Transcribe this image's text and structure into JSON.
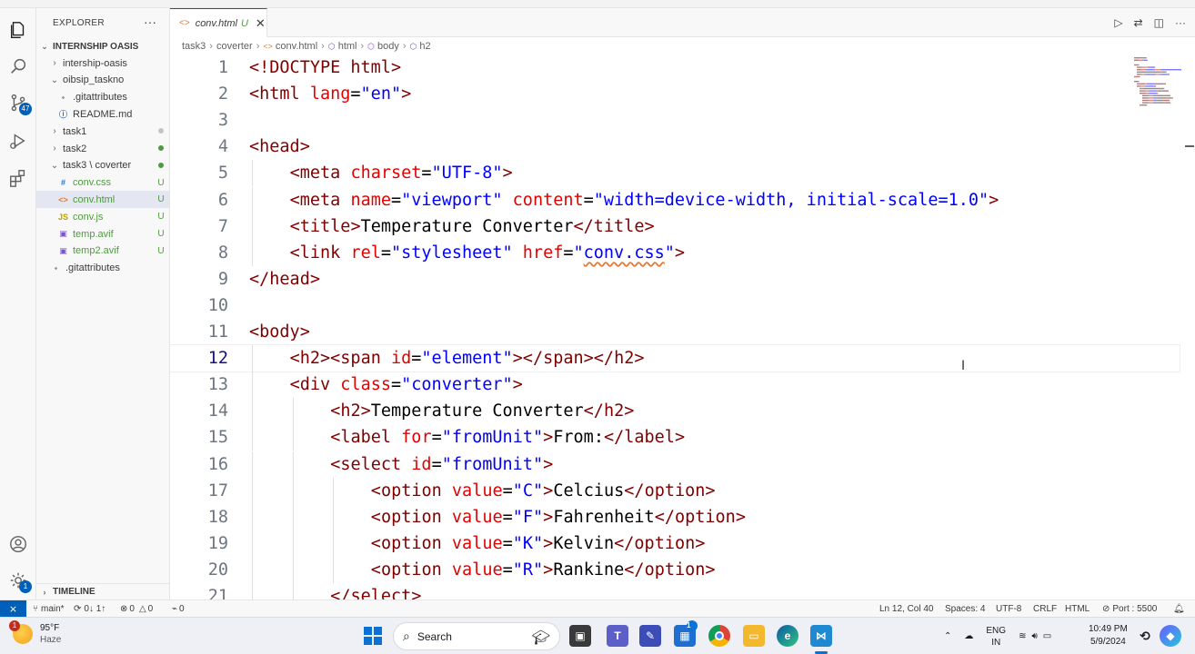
{
  "sidebar": {
    "title": "EXPLORER",
    "more": "···",
    "folder": "INTERNSHIP OASIS",
    "items": [
      {
        "label": "intership-oasis",
        "type": "folder",
        "expanded": false,
        "indent": 1,
        "status": ""
      },
      {
        "label": "oibsip_taskno",
        "type": "folder",
        "expanded": true,
        "indent": 1,
        "status": ""
      },
      {
        "label": ".gitattributes",
        "type": "git",
        "indent": 2,
        "status": ""
      },
      {
        "label": "README.md",
        "type": "info",
        "indent": 2,
        "status": ""
      },
      {
        "label": "task1",
        "type": "folder",
        "expanded": false,
        "indent": 1,
        "status": "dot"
      },
      {
        "label": "task2",
        "type": "folder",
        "expanded": false,
        "indent": 1,
        "status": "dot"
      },
      {
        "label": "task3 \\ coverter",
        "type": "folder",
        "expanded": true,
        "indent": 1,
        "status": "dot"
      },
      {
        "label": "conv.css",
        "type": "css",
        "indent": 2,
        "status": "U"
      },
      {
        "label": "conv.html",
        "type": "html",
        "indent": 2,
        "status": "U",
        "selected": true
      },
      {
        "label": "conv.js",
        "type": "js",
        "indent": 2,
        "status": "U"
      },
      {
        "label": "temp.avif",
        "type": "image",
        "indent": 2,
        "status": "U"
      },
      {
        "label": "temp2.avif",
        "type": "image",
        "indent": 2,
        "status": "U"
      },
      {
        "label": ".gitattributes",
        "type": "git",
        "indent": 1,
        "status": ""
      }
    ],
    "timeline": "TIMELINE"
  },
  "activity": {
    "scm_badge": "47",
    "settings_badge": "1"
  },
  "tab": {
    "label": "conv.html",
    "status": "U",
    "close": "✕"
  },
  "breadcrumb": [
    "task3",
    "coverter",
    "conv.html",
    "html",
    "body",
    "h2"
  ],
  "editor": {
    "current_line": 12,
    "lines": [
      {
        "n": 1,
        "indent": 0,
        "tokens": [
          [
            "br",
            "<"
          ],
          [
            "tag",
            "!DOCTYPE"
          ],
          [
            "txt",
            " "
          ],
          [
            "tag",
            "html"
          ],
          [
            "br",
            ">"
          ]
        ]
      },
      {
        "n": 2,
        "indent": 0,
        "tokens": [
          [
            "br",
            "<"
          ],
          [
            "tag",
            "html"
          ],
          [
            "txt",
            " "
          ],
          [
            "attr",
            "lang"
          ],
          [
            "txt",
            "="
          ],
          [
            "val",
            "\"en\""
          ],
          [
            "br",
            ">"
          ]
        ]
      },
      {
        "n": 3,
        "indent": 0,
        "tokens": []
      },
      {
        "n": 4,
        "indent": 0,
        "tokens": [
          [
            "br",
            "<"
          ],
          [
            "tag",
            "head"
          ],
          [
            "br",
            ">"
          ]
        ]
      },
      {
        "n": 5,
        "indent": 1,
        "tokens": [
          [
            "br",
            "<"
          ],
          [
            "tag",
            "meta"
          ],
          [
            "txt",
            " "
          ],
          [
            "attr",
            "charset"
          ],
          [
            "txt",
            "="
          ],
          [
            "val",
            "\"UTF-8\""
          ],
          [
            "br",
            ">"
          ]
        ]
      },
      {
        "n": 6,
        "indent": 1,
        "tokens": [
          [
            "br",
            "<"
          ],
          [
            "tag",
            "meta"
          ],
          [
            "txt",
            " "
          ],
          [
            "attr",
            "name"
          ],
          [
            "txt",
            "="
          ],
          [
            "val",
            "\"viewport\""
          ],
          [
            "txt",
            " "
          ],
          [
            "attr",
            "content"
          ],
          [
            "txt",
            "="
          ],
          [
            "val",
            "\"width=device-width, initial-scale=1.0\""
          ],
          [
            "br",
            ">"
          ]
        ]
      },
      {
        "n": 7,
        "indent": 1,
        "tokens": [
          [
            "br",
            "<"
          ],
          [
            "tag",
            "title"
          ],
          [
            "br",
            ">"
          ],
          [
            "txt",
            "Temperature Converter"
          ],
          [
            "br",
            "</"
          ],
          [
            "tag",
            "title"
          ],
          [
            "br",
            ">"
          ]
        ]
      },
      {
        "n": 8,
        "indent": 1,
        "tokens": [
          [
            "br",
            "<"
          ],
          [
            "tag",
            "link"
          ],
          [
            "txt",
            " "
          ],
          [
            "attr",
            "rel"
          ],
          [
            "txt",
            "="
          ],
          [
            "val",
            "\"stylesheet\""
          ],
          [
            "txt",
            " "
          ],
          [
            "attr",
            "href"
          ],
          [
            "txt",
            "="
          ],
          [
            "val",
            "\""
          ],
          [
            "valu",
            "conv.css"
          ],
          [
            "val",
            "\""
          ],
          [
            "br",
            ">"
          ]
        ]
      },
      {
        "n": 9,
        "indent": 0,
        "tokens": [
          [
            "br",
            "</"
          ],
          [
            "tag",
            "head"
          ],
          [
            "br",
            ">"
          ]
        ]
      },
      {
        "n": 10,
        "indent": 0,
        "tokens": []
      },
      {
        "n": 11,
        "indent": 0,
        "tokens": [
          [
            "br",
            "<"
          ],
          [
            "tag",
            "body"
          ],
          [
            "br",
            ">"
          ]
        ]
      },
      {
        "n": 12,
        "indent": 1,
        "tokens": [
          [
            "br",
            "<"
          ],
          [
            "tag",
            "h2"
          ],
          [
            "br",
            "><"
          ],
          [
            "tag",
            "span"
          ],
          [
            "txt",
            " "
          ],
          [
            "attr",
            "id"
          ],
          [
            "txt",
            "="
          ],
          [
            "val",
            "\"element\""
          ],
          [
            "br",
            "></"
          ],
          [
            "tag",
            "span"
          ],
          [
            "br",
            "></"
          ],
          [
            "tag",
            "h2"
          ],
          [
            "br",
            ">"
          ]
        ]
      },
      {
        "n": 13,
        "indent": 1,
        "tokens": [
          [
            "br",
            "<"
          ],
          [
            "tag",
            "div"
          ],
          [
            "txt",
            " "
          ],
          [
            "attr",
            "class"
          ],
          [
            "txt",
            "="
          ],
          [
            "val",
            "\"converter\""
          ],
          [
            "br",
            ">"
          ]
        ]
      },
      {
        "n": 14,
        "indent": 2,
        "tokens": [
          [
            "br",
            "<"
          ],
          [
            "tag",
            "h2"
          ],
          [
            "br",
            ">"
          ],
          [
            "txt",
            "Temperature Converter"
          ],
          [
            "br",
            "</"
          ],
          [
            "tag",
            "h2"
          ],
          [
            "br",
            ">"
          ]
        ]
      },
      {
        "n": 15,
        "indent": 2,
        "tokens": [
          [
            "br",
            "<"
          ],
          [
            "tag",
            "label"
          ],
          [
            "txt",
            " "
          ],
          [
            "attr",
            "for"
          ],
          [
            "txt",
            "="
          ],
          [
            "val",
            "\"fromUnit\""
          ],
          [
            "br",
            ">"
          ],
          [
            "txt",
            "From:"
          ],
          [
            "br",
            "</"
          ],
          [
            "tag",
            "label"
          ],
          [
            "br",
            ">"
          ]
        ]
      },
      {
        "n": 16,
        "indent": 2,
        "tokens": [
          [
            "br",
            "<"
          ],
          [
            "tag",
            "select"
          ],
          [
            "txt",
            " "
          ],
          [
            "attr",
            "id"
          ],
          [
            "txt",
            "="
          ],
          [
            "val",
            "\"fromUnit\""
          ],
          [
            "br",
            ">"
          ]
        ]
      },
      {
        "n": 17,
        "indent": 3,
        "tokens": [
          [
            "br",
            "<"
          ],
          [
            "tag",
            "option"
          ],
          [
            "txt",
            " "
          ],
          [
            "attr",
            "value"
          ],
          [
            "txt",
            "="
          ],
          [
            "val",
            "\"C\""
          ],
          [
            "br",
            ">"
          ],
          [
            "txt",
            "Celcius"
          ],
          [
            "br",
            "</"
          ],
          [
            "tag",
            "option"
          ],
          [
            "br",
            ">"
          ]
        ]
      },
      {
        "n": 18,
        "indent": 3,
        "tokens": [
          [
            "br",
            "<"
          ],
          [
            "tag",
            "option"
          ],
          [
            "txt",
            " "
          ],
          [
            "attr",
            "value"
          ],
          [
            "txt",
            "="
          ],
          [
            "val",
            "\"F\""
          ],
          [
            "br",
            ">"
          ],
          [
            "txt",
            "Fahrenheit"
          ],
          [
            "br",
            "</"
          ],
          [
            "tag",
            "option"
          ],
          [
            "br",
            ">"
          ]
        ]
      },
      {
        "n": 19,
        "indent": 3,
        "tokens": [
          [
            "br",
            "<"
          ],
          [
            "tag",
            "option"
          ],
          [
            "txt",
            " "
          ],
          [
            "attr",
            "value"
          ],
          [
            "txt",
            "="
          ],
          [
            "val",
            "\"K\""
          ],
          [
            "br",
            ">"
          ],
          [
            "txt",
            "Kelvin"
          ],
          [
            "br",
            "</"
          ],
          [
            "tag",
            "option"
          ],
          [
            "br",
            ">"
          ]
        ]
      },
      {
        "n": 20,
        "indent": 3,
        "tokens": [
          [
            "br",
            "<"
          ],
          [
            "tag",
            "option"
          ],
          [
            "txt",
            " "
          ],
          [
            "attr",
            "value"
          ],
          [
            "txt",
            "="
          ],
          [
            "val",
            "\"R\""
          ],
          [
            "br",
            ">"
          ],
          [
            "txt",
            "Rankine"
          ],
          [
            "br",
            "</"
          ],
          [
            "tag",
            "option"
          ],
          [
            "br",
            ">"
          ]
        ]
      },
      {
        "n": 21,
        "indent": 2,
        "tokens": [
          [
            "br",
            "</"
          ],
          [
            "tag",
            "select"
          ],
          [
            "br",
            ">"
          ]
        ]
      }
    ]
  },
  "statusbar": {
    "branch": "main*",
    "sync": "0↓ 1↑",
    "errors": "0",
    "warnings": "0",
    "ports": "0",
    "position": "Ln 12, Col 40",
    "spaces": "Spaces: 4",
    "encoding": "UTF-8",
    "eol": "CRLF",
    "language": "HTML",
    "port": "Port : 5500"
  },
  "taskbar": {
    "weather_temp": "95°F",
    "weather_desc": "Haze",
    "weather_badge": "1",
    "search": "Search",
    "lang_top": "ENG",
    "lang_bottom": "IN",
    "time": "10:49 PM",
    "date": "5/9/2024",
    "store_badge": "1"
  },
  "colors": {
    "accent": "#005fb8",
    "tag": "#800000",
    "attr": "#e50000",
    "value": "#0000ff",
    "untracked": "#4f9a3f"
  }
}
